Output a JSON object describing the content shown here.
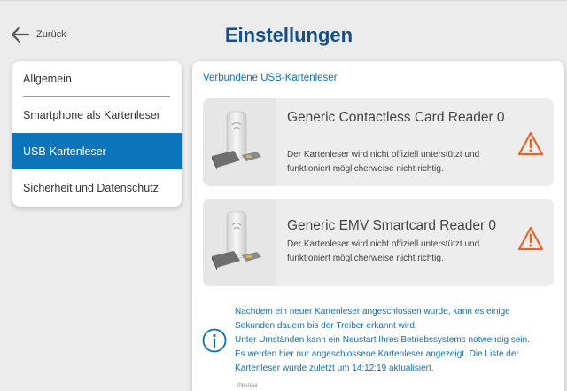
{
  "header": {
    "back_label": "Zurück",
    "title": "Einstellungen"
  },
  "sidebar": {
    "items": [
      {
        "label": "Allgemein",
        "active": false
      },
      {
        "label": "Smartphone als Kartenleser",
        "active": false
      },
      {
        "label": "USB-Kartenleser",
        "active": true
      },
      {
        "label": "Sicherheit und Datenschutz",
        "active": false
      }
    ]
  },
  "main": {
    "section_title": "Verbundene USB-Kartenleser",
    "readers": [
      {
        "name": "Generic Contactless Card Reader 0",
        "description_line1": "Der Kartenleser wird nicht offiziell unterstützt und",
        "description_line2": "funktioniert möglicherweise nicht richtig.",
        "status_icon": "warning-icon"
      },
      {
        "name": "Generic EMV Smartcard Reader 0",
        "description_line1": "Der Kartenleser wird nicht offiziell unterstützt und",
        "description_line2": "funktioniert möglicherweise nicht richtig.",
        "status_icon": "warning-icon"
      }
    ],
    "info_lines": [
      "Nachdem ein neuer Kartenleser angeschlossen wurde, kann es einige",
      "Sekunden dauern bis der Treiber erkannt wird.",
      "Unter Umständen kann ein Neustart Ihres Betriebssystems notwendig sein.",
      "Es werden hier nur angeschlossene Kartenleser angezeigt. Die Liste der",
      "Kartenleser wurde zuletzt um 14:12:19 aktualisiert."
    ],
    "cut_text": "(Neu)Aa"
  },
  "colors": {
    "accent": "#0b74bb",
    "title": "#164f86",
    "warning": "#e0682a",
    "info": "#0b6fb6"
  }
}
